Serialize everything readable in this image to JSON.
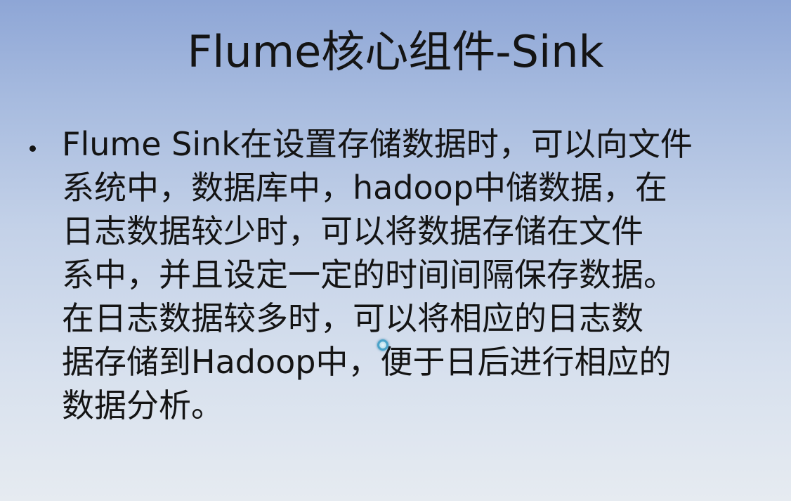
{
  "slide": {
    "title": "Flume核心组件-Sink",
    "bullets": [
      {
        "lines": [
          "Flume Sink在设置存储数据时，可以向文件",
          "系统中，数据库中，hadoop中储数据，在",
          "日志数据较少时，可以将数据存储在文件",
          "系中，并且设定一定的时间间隔保存数据。",
          "在日志数据较多时，可以将相应的日志数",
          "据存储到Hadoop中，便于日后进行相应的",
          "数据分析。"
        ]
      }
    ]
  },
  "icons": {
    "bullet": "bullet-dot-icon",
    "cursor": "busy-cursor-icon"
  },
  "colors": {
    "text": "#141414",
    "background_top": "#8ea6d6",
    "background_bottom": "#e6ebf1",
    "cursor_ring": "#4aa3c9"
  }
}
